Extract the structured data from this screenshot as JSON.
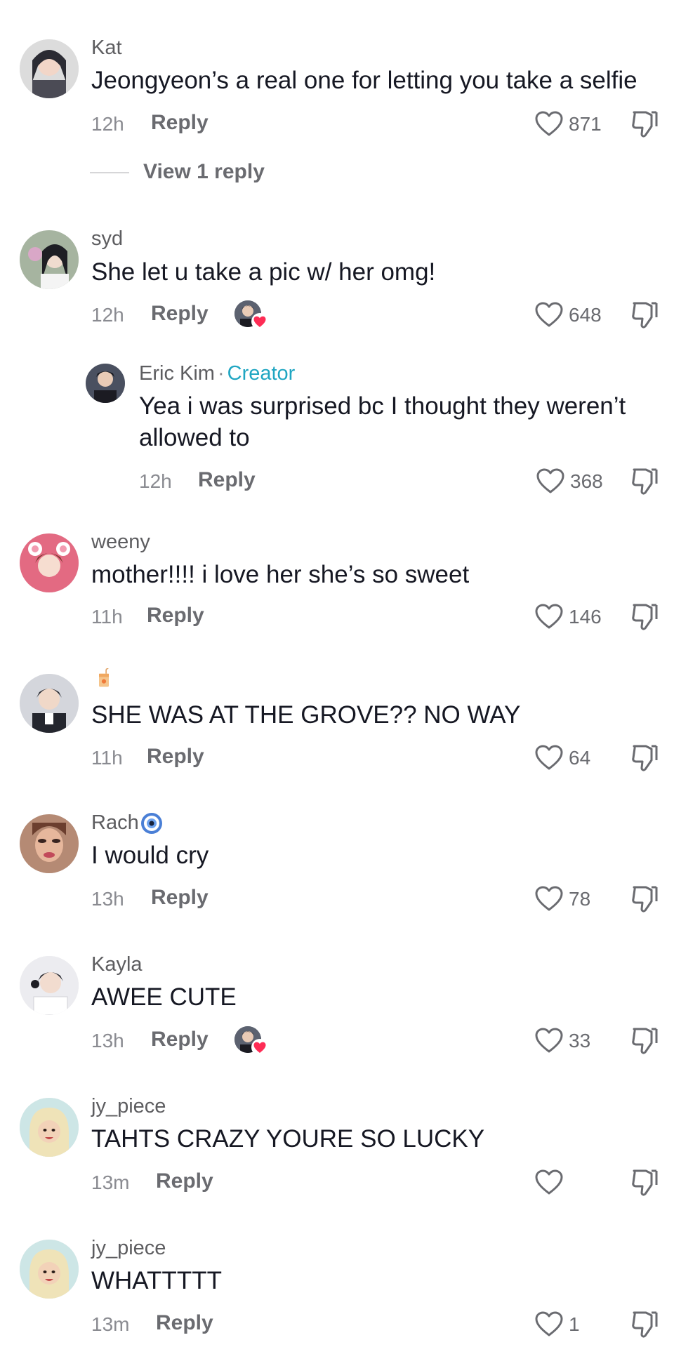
{
  "comments": [
    {
      "username": "Kat",
      "text": "Jeongyeon’s a real one for letting you take a selfie",
      "time": "12h",
      "reply_label": "Reply",
      "likes": "871",
      "view_replies": "View 1 reply",
      "avatar_color": "#2b2b33"
    },
    {
      "username": "syd",
      "text": "She let u take a pic w/ her omg!",
      "time": "12h",
      "reply_label": "Reply",
      "likes": "648",
      "creator_liked": true,
      "avatar_color": "#7e8a93"
    },
    {
      "username": "Eric Kim",
      "separator": "·",
      "creator_label": "Creator",
      "text_line1": "Yea i was surprised bc I thought they weren’t",
      "text_line2": "allowed to",
      "time": "12h",
      "reply_label": "Reply",
      "likes": "368",
      "avatar_color": "#353a45"
    },
    {
      "username": "weeny",
      "text": "mother!!!! i love her she’s so sweet",
      "time": "11h",
      "reply_label": "Reply",
      "likes": "146",
      "avatar_color": "#d9536b"
    },
    {
      "username": "",
      "text": "SHE WAS AT THE GROVE?? NO WAY",
      "time": "11h",
      "reply_label": "Reply",
      "likes": "64",
      "username_icon": "juice-box-icon",
      "avatar_color": "#3a3d46"
    },
    {
      "username": "Rach",
      "username_icon": "evil-eye-icon",
      "text": "I would cry",
      "time": "13h",
      "reply_label": "Reply",
      "likes": "78",
      "avatar_color": "#8c6a5a"
    },
    {
      "username": "Kayla",
      "text": "AWEE CUTE",
      "time": "13h",
      "reply_label": "Reply",
      "likes": "33",
      "creator_liked": true,
      "avatar_color": "#c9c9cf"
    },
    {
      "username": "jy_piece",
      "text": "TAHTS CRAZY YOURE SO LUCKY",
      "time": "13m",
      "reply_label": "Reply",
      "likes": "",
      "avatar_color": "#e8d98a"
    },
    {
      "username": "jy_piece",
      "text": "WHATTTTT",
      "time": "13m",
      "reply_label": "Reply",
      "likes": "1",
      "avatar_color": "#e8d98a"
    }
  ],
  "colors": {
    "creator_accent": "#20a6c2",
    "heart_badge": "#fe2c55",
    "evil_eye": "#4a7fd6"
  }
}
